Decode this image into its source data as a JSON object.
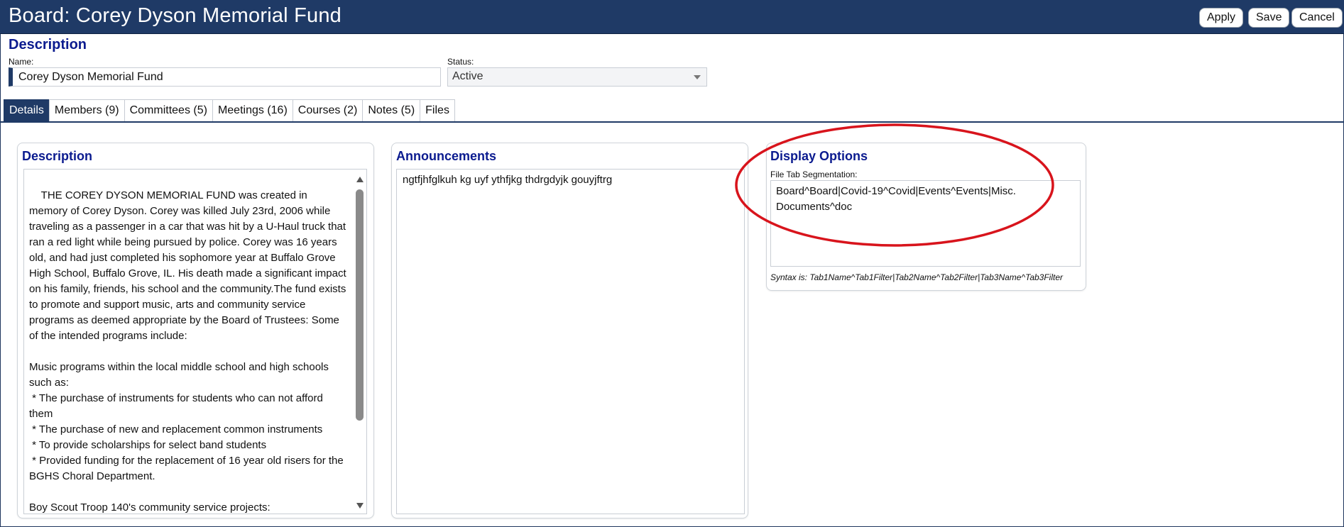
{
  "header": {
    "title": "Board: Corey Dyson Memorial Fund",
    "buttons": {
      "apply": "Apply",
      "save": "Save",
      "cancel": "Cancel"
    }
  },
  "description_section": {
    "title": "Description",
    "name_label": "Name:",
    "name_value": "Corey Dyson Memorial Fund",
    "status_label": "Status:",
    "status_value": "Active"
  },
  "tabs": [
    {
      "label": "Details",
      "active": true
    },
    {
      "label": "Members (9)"
    },
    {
      "label": "Committees (5)"
    },
    {
      "label": "Meetings (16)"
    },
    {
      "label": "Courses (2)"
    },
    {
      "label": "Notes (5)"
    },
    {
      "label": "Files"
    }
  ],
  "panels": {
    "description": {
      "title": "Description",
      "text": "THE COREY DYSON MEMORIAL FUND was created in memory of Corey Dyson. Corey was killed July 23rd, 2006 while traveling as a passenger in a car that was hit by a U-Haul truck that ran a red light while being pursued by police. Corey was 16 years old, and had just completed his sophomore year at Buffalo Grove High School, Buffalo Grove, IL. His death made a significant impact on his family, friends, his school and the community.The fund exists to promote and support music, arts and community service programs as deemed appropriate by the Board of Trustees: Some of the intended programs include:\n\nMusic programs within the local middle school and high schools such as:\n * The purchase of instruments for students who can not afford them\n * The purchase of new and replacement common instruments\n * To provide scholarships for select band students\n * Provided funding for the replacement of 16 year old risers for the BGHS Choral Department.\n\nBoy Scout Troop 140's community service projects:\n * The purchase of food and materials for a soup kitchen in"
    },
    "announcements": {
      "title": "Announcements",
      "text": "ngtfjhfglkuh kg uyf ythfjkg thdrgdyjk gouyjftrg"
    },
    "display_options": {
      "title": "Display Options",
      "field_label": "File Tab Segmentation:",
      "field_value": "Board^Board|Covid-19^Covid|Events^Events|Misc. Documents^doc",
      "syntax_hint": "Syntax is: Tab1Name^Tab1Filter|Tab2Name^Tab2Filter|Tab3Name^Tab3Filter"
    }
  },
  "colors": {
    "header_bg": "#1f3a66",
    "section_title": "#0b1b8f",
    "annotation_red": "#d8141c"
  }
}
